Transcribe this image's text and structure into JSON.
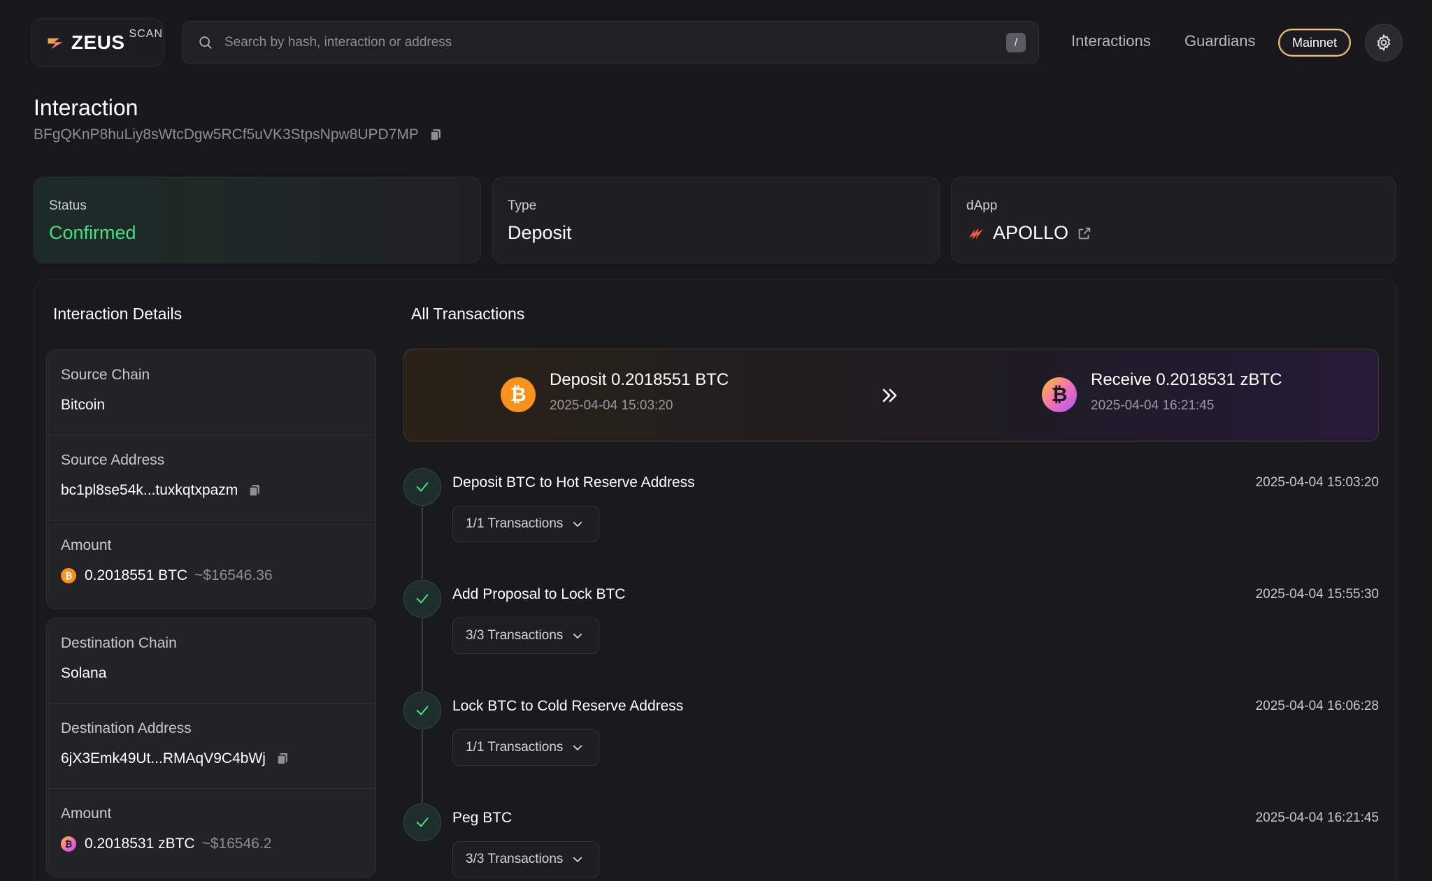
{
  "header": {
    "logo_text": "ZEUS",
    "logo_sup": "SCAN",
    "search_placeholder": "Search by hash, interaction or address",
    "search_shortcut": "/",
    "nav": [
      "Interactions",
      "Guardians"
    ],
    "network": "Mainnet"
  },
  "page": {
    "title": "Interaction",
    "hash": "BFgQKnP8huLiy8sWtcDgw5RCf5uVK3StpsNpw8UPD7MP"
  },
  "summary": {
    "status_label": "Status",
    "status_value": "Confirmed",
    "type_label": "Type",
    "type_value": "Deposit",
    "dapp_label": "dApp",
    "dapp_value": "APOLLO"
  },
  "details": {
    "title": "Interaction Details",
    "source_chain_label": "Source Chain",
    "source_chain": "Bitcoin",
    "source_address_label": "Source Address",
    "source_address": "bc1pl8se54k...tuxkqtxpazm",
    "source_amount_label": "Amount",
    "source_amount": "0.2018551 BTC",
    "source_amount_usd": "~$16546.36",
    "dest_chain_label": "Destination Chain",
    "dest_chain": "Solana",
    "dest_address_label": "Destination Address",
    "dest_address": "6jX3Emk49Ut...RMAqV9C4bWj",
    "dest_amount_label": "Amount",
    "dest_amount": "0.2018531 zBTC",
    "dest_amount_usd": "~$16546.2"
  },
  "transactions": {
    "title": "All Transactions",
    "deposit_title": "Deposit 0.2018551 BTC",
    "deposit_time": "2025-04-04 15:03:20",
    "receive_title": "Receive 0.2018531 zBTC",
    "receive_time": "2025-04-04 16:21:45",
    "steps": [
      {
        "title": "Deposit BTC to Hot Reserve Address",
        "time": "2025-04-04 15:03:20",
        "tx": "1/1 Transactions"
      },
      {
        "title": "Add Proposal to Lock BTC",
        "time": "2025-04-04 15:55:30",
        "tx": "3/3 Transactions"
      },
      {
        "title": "Lock BTC to Cold Reserve Address",
        "time": "2025-04-04 16:06:28",
        "tx": "1/1 Transactions"
      },
      {
        "title": "Peg BTC",
        "time": "2025-04-04 16:21:45",
        "tx": "3/3 Transactions"
      }
    ]
  },
  "colors": {
    "background": "#18181c",
    "confirmed_green": "#4ade80",
    "btc_orange": "#f7931a",
    "zbtc_pink": "#e879f9",
    "mainnet_border": "#e7c96a"
  },
  "icons": [
    "zeus-logo-icon",
    "search-icon",
    "gear-icon",
    "copy-icon",
    "apollo-icon",
    "external-link-icon",
    "btc-coin-icon",
    "zbtc-coin-icon",
    "double-chevron-right-icon",
    "check-icon",
    "chevron-down-icon"
  ]
}
